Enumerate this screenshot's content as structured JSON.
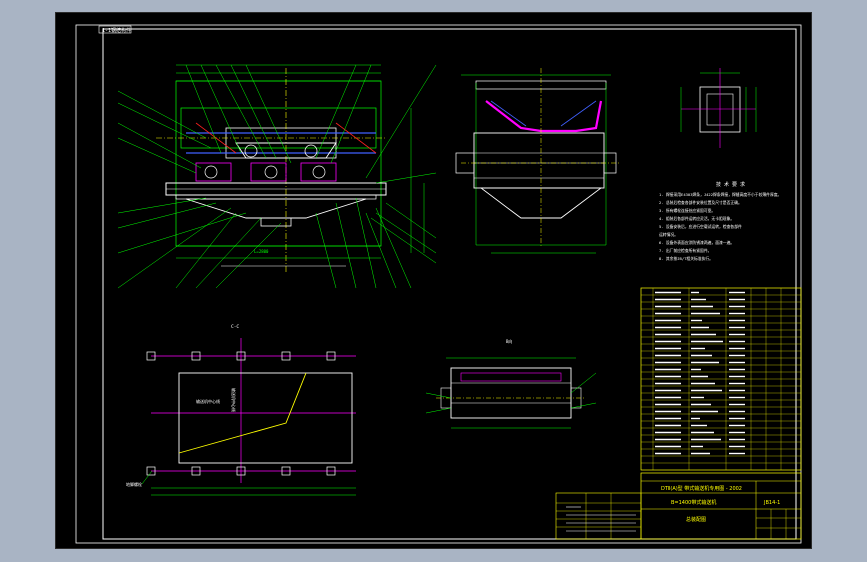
{
  "drawing": {
    "sheet_tag": "1-1钢结构件",
    "title_block": {
      "project": "DTⅡ(A)型  带式输送机专用图 - 2002",
      "drawing_name": "B=1400带式输送机",
      "drawing_no": "JB14-1",
      "view_name": "总装配图"
    },
    "notes_title": "技 术 要 求",
    "notes": [
      "1. 焊接采用E4303焊条，J422焊条焊接，焊缝高度不小于较薄件厚度。",
      "2. 总装后检查各部件安装位置及尺寸是否正确。",
      "3. 所有螺栓连接处应紧固可靠。",
      "4. 组装后各部件运转应灵活，无卡阻现象。",
      "5. 设备安装后，应进行空载试运转，检查各部件",
      "   运转情况。",
      "6. 设备外表面应涂防锈漆两遍，面漆一遍。",
      "7. 出厂前应检查所有紧固件。",
      "8. 其余按JB/T相关标准执行。"
    ],
    "section_labels": [
      "C-C",
      "B向",
      "1-1"
    ],
    "bottom_annot": "地脚螺栓",
    "plan_note": "输送机中心线",
    "plan_note2": "输送机中心线",
    "accent_colors": {
      "green": "#00ff00",
      "magenta": "#ff00ff",
      "yellow": "#ffff00",
      "cyan": "#00ffff",
      "white": "#ffffff",
      "blue": "#4060ff",
      "red": "#ff2020"
    }
  }
}
